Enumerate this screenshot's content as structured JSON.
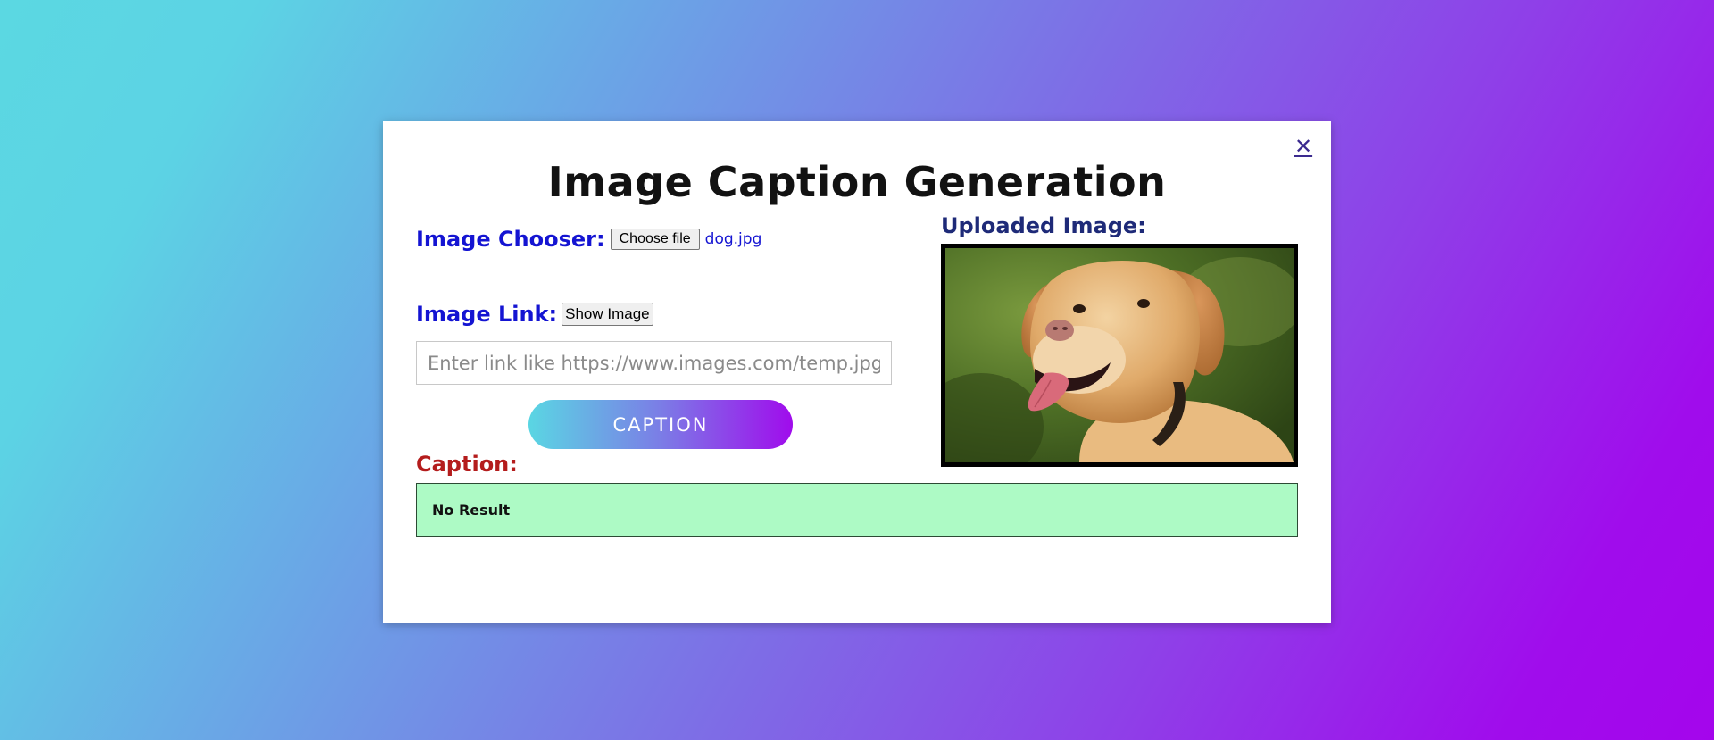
{
  "modal": {
    "title": "Image Caption Generation",
    "close_icon": "close-icon",
    "close_glyph": "✕"
  },
  "chooser": {
    "label": "Image Chooser:",
    "button_label": "Choose file",
    "file_name": "dog.jpg"
  },
  "link": {
    "label": "Image Link:",
    "button_label": "Show Image",
    "placeholder": "Enter link like https://www.images.com/temp.jpg",
    "value": ""
  },
  "caption_button": {
    "label": "CAPTION"
  },
  "caption": {
    "label": "Caption:",
    "result": "No Result"
  },
  "uploaded": {
    "label": "Uploaded Image:",
    "image_subject": "golden retriever dog photo"
  },
  "colors": {
    "label_blue": "#1414d2",
    "label_dark_blue": "#1e2a78",
    "caption_red": "#b41c1c",
    "result_green": "#adfac5",
    "gradient_start": "#5bd8e2",
    "gradient_end": "#a405ec"
  }
}
